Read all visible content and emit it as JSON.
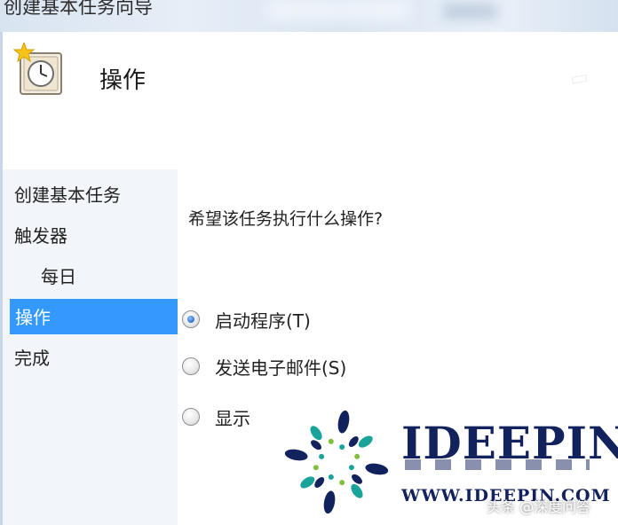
{
  "window": {
    "title": "创建基本任务向导"
  },
  "header": {
    "title": "操作",
    "icon": "clock-icon"
  },
  "sidebar": {
    "items": [
      {
        "label": "创建基本任务"
      },
      {
        "label": "触发器"
      },
      {
        "label": "每日"
      },
      {
        "label": "操作",
        "selected": true
      },
      {
        "label": "完成"
      }
    ],
    "selected_color": "#3399ff"
  },
  "main": {
    "question": "希望该任务执行什么操作?",
    "options": [
      {
        "label": "启动程序(T)",
        "checked": true
      },
      {
        "label": "发送电子邮件(S)",
        "checked": false
      },
      {
        "label": "显示",
        "checked": false
      }
    ]
  },
  "overlay": {
    "brand": "IDEEPIN",
    "url": "WWW.IDEEPIN.COM",
    "watermark": "头条 @深度问答",
    "brand_color": "#12225c",
    "accent_color": "#1aa39a"
  }
}
